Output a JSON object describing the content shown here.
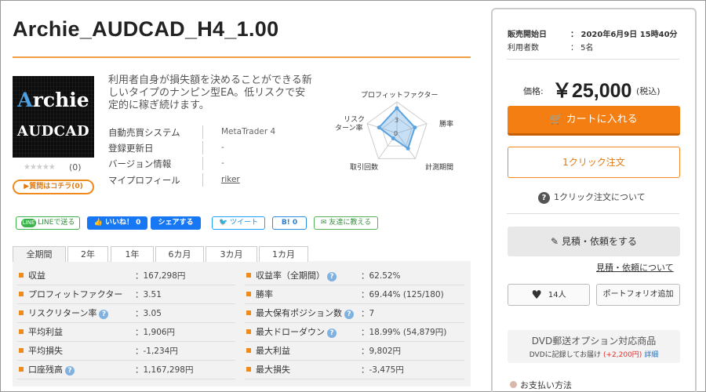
{
  "product": {
    "title": "Archie_AUDCAD_H4_1.00",
    "logo_word": "Archie",
    "logo_word_first": "A",
    "logo_word_rest": "rchie",
    "logo_sub": "AUDCAD",
    "stars": "★★★★★",
    "review_count": "(0)",
    "question_button": "▶質問はコチラ(0)",
    "description": "利用者自身が損失額を決めることができる新しいタイプのナンピン型EA。低リスクで安定的に稼ぎ続けます。",
    "info": [
      {
        "label": "自動売買システム",
        "value": "MetaTrader 4"
      },
      {
        "label": "登録更新日",
        "value": "-"
      },
      {
        "label": "バージョン情報",
        "value": "-"
      },
      {
        "label": "マイプロフィール",
        "value": "riker"
      }
    ]
  },
  "radar": {
    "labels": [
      "プロフィットファクター",
      "勝率",
      "計測期間",
      "取引回数",
      "リスクターン率"
    ],
    "label_risk_line1": "リスク",
    "label_risk_line2": "ターン率",
    "values": [
      4,
      3,
      3,
      1,
      3
    ],
    "max": 5,
    "center_label": "0",
    "tick_label": "3",
    "accent": "#5ba3e0"
  },
  "social": {
    "line": "LINEで送る",
    "line_badge": "LINE",
    "like": "いいね！ 0",
    "share": "シェアする",
    "tweet": "ツイート",
    "hatena": "B! 0",
    "friend": "友達に教える"
  },
  "tabs": [
    "全期間",
    "2年",
    "1年",
    "6カ月",
    "3カ月",
    "1カ月"
  ],
  "stats_left": [
    {
      "label": "収益",
      "value": "：167,298円",
      "help": false
    },
    {
      "label": "プロフィットファクター",
      "value": "：3.51",
      "help": false
    },
    {
      "label": "リスクリターン率",
      "value": "：3.05",
      "help": true
    },
    {
      "label": "平均利益",
      "value": "：1,906円",
      "help": false
    },
    {
      "label": "平均損失",
      "value": "：-1,234円",
      "help": false
    },
    {
      "label": "口座残高",
      "value": "：1,167,298円",
      "help": true
    }
  ],
  "stats_right": [
    {
      "label": "収益率（全期間）",
      "value": "：62.52%",
      "help": true
    },
    {
      "label": "勝率",
      "value": "：69.44% (125/180)",
      "help": false
    },
    {
      "label": "最大保有ポジション数",
      "value": "：7",
      "help": true
    },
    {
      "label": "最大ドローダウン",
      "value": "：18.99% (54,879円)",
      "help": true
    },
    {
      "label": "最大利益",
      "value": "：9,802円",
      "help": false
    },
    {
      "label": "最大損失",
      "value": "：-3,475円",
      "help": false
    }
  ],
  "help_glyph": "?",
  "sidebar": {
    "release_label": "販売開始日",
    "release_value": "：  2020年6月9日 15時40分",
    "users_label": "利用者数",
    "users_value": "：  5名",
    "price_label": "価格:",
    "price": "￥25,000",
    "price_tax": "(税込)",
    "cart_button": "カートに入れる",
    "one_click_button": "1クリック注文",
    "one_click_about": "1クリック注文について",
    "estimate_button": "見積・依頼をする",
    "estimate_link": "見積・依頼について",
    "favorite_count": "14人",
    "portfolio_button": "ポートフォリオ追加",
    "dvd_title": "DVD郵送オプション対応商品",
    "dvd_note_a": "DVDに記録してお届け",
    "dvd_note_price": "(+2,200円)",
    "dvd_note_link": "詳細",
    "payment": "お支払い方法"
  },
  "colors": {
    "accent_orange": "#f57e12",
    "title_rule": "#f0a040",
    "facebook": "#1877f2",
    "line_green": "#3bb34a"
  }
}
